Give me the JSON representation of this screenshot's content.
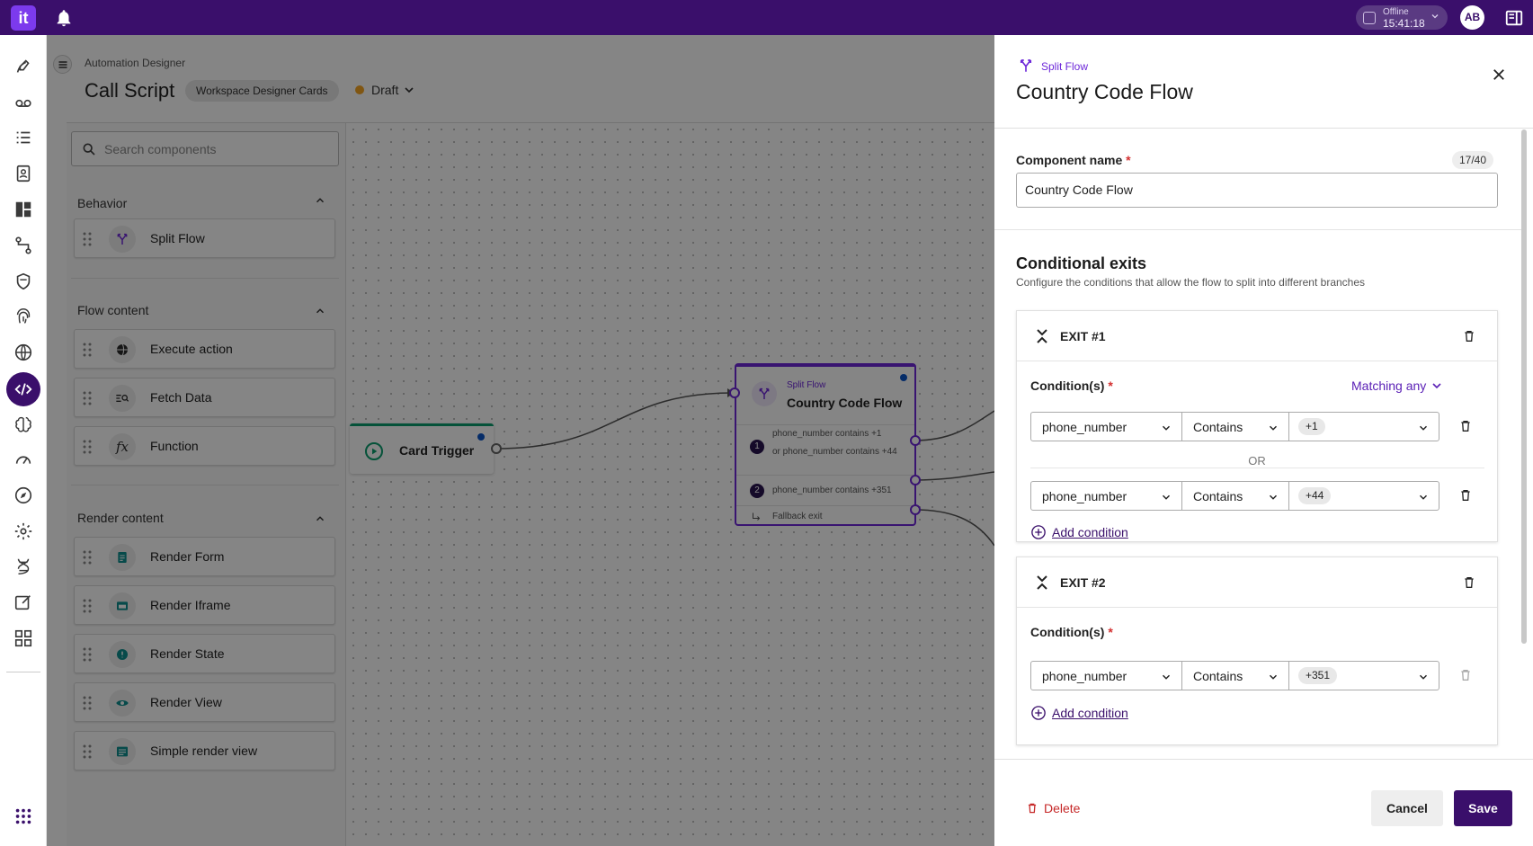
{
  "topbar": {
    "logo": "it",
    "status_label": "Offline",
    "status_time": "15:41:18",
    "avatar_initials": "AB"
  },
  "designer": {
    "breadcrumb": "Automation Designer",
    "title": "Call Script",
    "workspace_chip": "Workspace Designer Cards",
    "status": "Draft",
    "status_color": "#f5a623",
    "search_placeholder": "Search components",
    "sections": {
      "behavior": {
        "title": "Behavior",
        "items": [
          {
            "label": "Split Flow",
            "icon": "split-flow-icon"
          }
        ]
      },
      "flow_content": {
        "title": "Flow content",
        "items": [
          {
            "label": "Execute action",
            "icon": "globe-icon"
          },
          {
            "label": "Fetch Data",
            "icon": "fetch-data-icon"
          },
          {
            "label": "Function",
            "icon": "function-icon"
          }
        ]
      },
      "render_content": {
        "title": "Render content",
        "items": [
          {
            "label": "Render Form",
            "icon": "form-icon"
          },
          {
            "label": "Render Iframe",
            "icon": "iframe-icon"
          },
          {
            "label": "Render State",
            "icon": "info-state-icon"
          },
          {
            "label": "Render View",
            "icon": "eye-icon"
          },
          {
            "label": "Simple render view",
            "icon": "simple-view-icon"
          }
        ]
      }
    }
  },
  "canvas": {
    "trigger_node": {
      "label": "Card Trigger"
    },
    "split_node": {
      "subtitle": "Split Flow",
      "title": "Country Code Flow",
      "exit1_num": "1",
      "exit1_line1": "phone_number contains +1",
      "exit1_line2": "or phone_number contains +44",
      "exit2_num": "2",
      "exit2_line1": "phone_number contains +351",
      "fallback": "Fallback exit"
    }
  },
  "drawer": {
    "subtitle": "Split Flow",
    "title": "Country Code Flow",
    "component_name_label": "Component name",
    "required_mark": "*",
    "counter": "17/40",
    "component_name_value": "Country Code Flow",
    "conditional_title": "Conditional exits",
    "conditional_desc": "Configure the conditions that allow the flow to split into different branches",
    "exit1": {
      "title": "EXIT #1",
      "cond_label": "Condition(s)",
      "matching": "Matching any",
      "row1": {
        "field": "phone_number",
        "op": "Contains",
        "value": "+1"
      },
      "or_label": "OR",
      "row2": {
        "field": "phone_number",
        "op": "Contains",
        "value": "+44"
      },
      "add": "Add condition"
    },
    "exit2": {
      "title": "EXIT #2",
      "cond_label": "Condition(s)",
      "row1": {
        "field": "phone_number",
        "op": "Contains",
        "value": "+351"
      },
      "add": "Add condition"
    },
    "footer": {
      "delete": "Delete",
      "cancel": "Cancel",
      "save": "Save"
    }
  },
  "colors": {
    "brand": "#3a0f6b",
    "accent": "#6d28d9",
    "trigger": "#0a9d6e",
    "danger": "#c62828"
  }
}
